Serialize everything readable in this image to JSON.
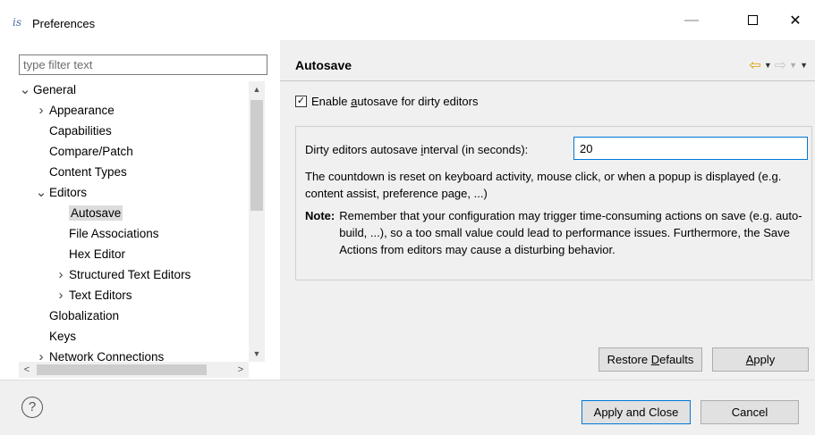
{
  "window": {
    "app_icon_text": "is",
    "title": "Preferences",
    "minimize_glyph": "—",
    "close_glyph": "✕"
  },
  "sidebar": {
    "filter_placeholder": "type filter text",
    "tree": [
      {
        "label": "General",
        "arrow": "v"
      },
      {
        "label": "Appearance",
        "arrow": ">"
      },
      {
        "label": "Capabilities",
        "arrow": ""
      },
      {
        "label": "Compare/Patch",
        "arrow": ""
      },
      {
        "label": "Content Types",
        "arrow": ""
      },
      {
        "label": "Editors",
        "arrow": "v"
      },
      {
        "label": "Autosave",
        "arrow": "",
        "selected": true
      },
      {
        "label": "File Associations",
        "arrow": ""
      },
      {
        "label": "Hex Editor",
        "arrow": ""
      },
      {
        "label": "Structured Text Editors",
        "arrow": ">"
      },
      {
        "label": "Text Editors",
        "arrow": ">"
      },
      {
        "label": "Globalization",
        "arrow": ""
      },
      {
        "label": "Keys",
        "arrow": ""
      },
      {
        "label": "Network Connections",
        "arrow": ">"
      }
    ]
  },
  "page": {
    "title": "Autosave",
    "enable_checkbox": {
      "label_before": "Enable ",
      "label_mnemonic": "a",
      "label_after": "utosave for dirty editors",
      "checked": "✓"
    },
    "interval": {
      "label_before": "Dirty editors autosave ",
      "label_mnemonic": "i",
      "label_after": "nterval (in seconds):",
      "value": "20"
    },
    "description": "The countdown is reset on keyboard activity, mouse click, or when a popup is displayed (e.g. content assist, preference page, ...)",
    "note_label": "Note:",
    "note_text": "Remember that your configuration may trigger time-consuming actions on save (e.g. auto-build, ...), so a too small value could lead to performance issues. Furthermore, the Save Actions from editors may cause a disturbing behavior."
  },
  "buttons": {
    "restore_before": "Restore ",
    "restore_mnemonic": "D",
    "restore_after": "efaults",
    "apply_mnemonic": "A",
    "apply_after": "pply",
    "apply_and_close": "Apply and Close",
    "cancel": "Cancel",
    "help": "?"
  },
  "colors": {
    "accent": "#0078d7",
    "back_arrow": "#e0a000"
  }
}
